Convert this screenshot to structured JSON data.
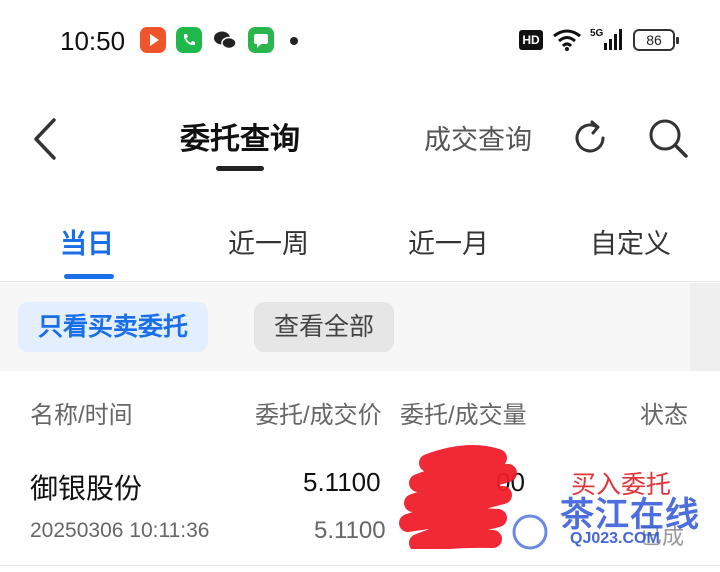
{
  "status_bar": {
    "time": "10:50",
    "hd": "HD",
    "battery": "86"
  },
  "nav": {
    "title": "委托查询",
    "secondary": "成交查询"
  },
  "tabs": [
    {
      "label": "当日"
    },
    {
      "label": "近一周"
    },
    {
      "label": "近一月"
    },
    {
      "label": "自定义"
    }
  ],
  "filters": {
    "primary": "只看买卖委托",
    "secondary": "查看全部"
  },
  "table": {
    "headers": {
      "name": "名称/时间",
      "price": "委托/成交价",
      "qty": "委托/成交量",
      "status": "状态"
    },
    "rows": [
      {
        "name": "御银股份",
        "time": "20250306 10:11:36",
        "price_order": "5.1100",
        "price_deal": "5.1100",
        "qty_order": "00",
        "status": "买入委托",
        "status2": "已成"
      }
    ]
  },
  "watermark": {
    "text": "茶江在线",
    "sub": "QJ023.COM"
  },
  "colors": {
    "accent": "#1a6fe8",
    "buy": "#e0343c"
  }
}
